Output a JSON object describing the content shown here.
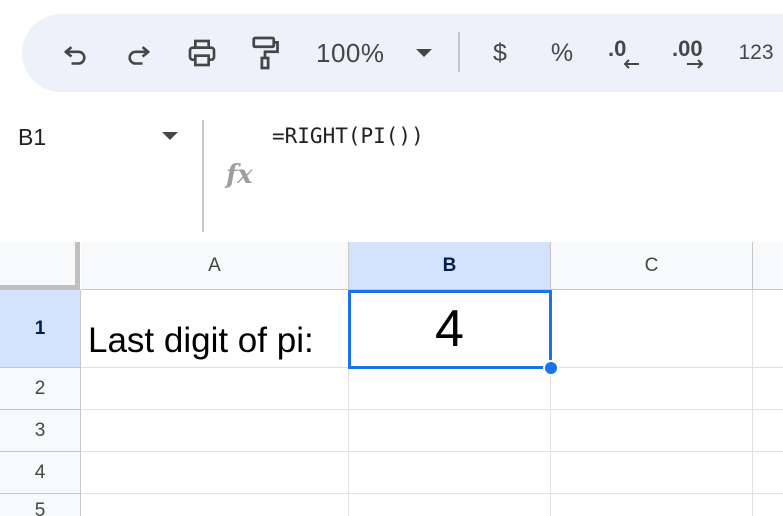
{
  "toolbar": {
    "undo_icon": "undo-icon",
    "redo_icon": "redo-icon",
    "print_icon": "print-icon",
    "paint_format_icon": "paint-format-icon",
    "zoom": "100%",
    "currency": "$",
    "percent": "%",
    "decrease_decimal": ".0",
    "increase_decimal": ".00",
    "number_format": "123"
  },
  "formula_bar": {
    "name_box": "B1",
    "fx": "fx",
    "formula": "=RIGHT(PI())"
  },
  "grid": {
    "columns": [
      "A",
      "B",
      "C"
    ],
    "rows": [
      "1",
      "2",
      "3",
      "4",
      "5"
    ],
    "selected_cell": "B1",
    "cells": {
      "A1": "Last digit of pi:",
      "B1": "4"
    }
  },
  "colors": {
    "selection": "#1a73e8",
    "header_selected": "#d3e3fd",
    "toolbar_bg": "#edf2fa"
  }
}
